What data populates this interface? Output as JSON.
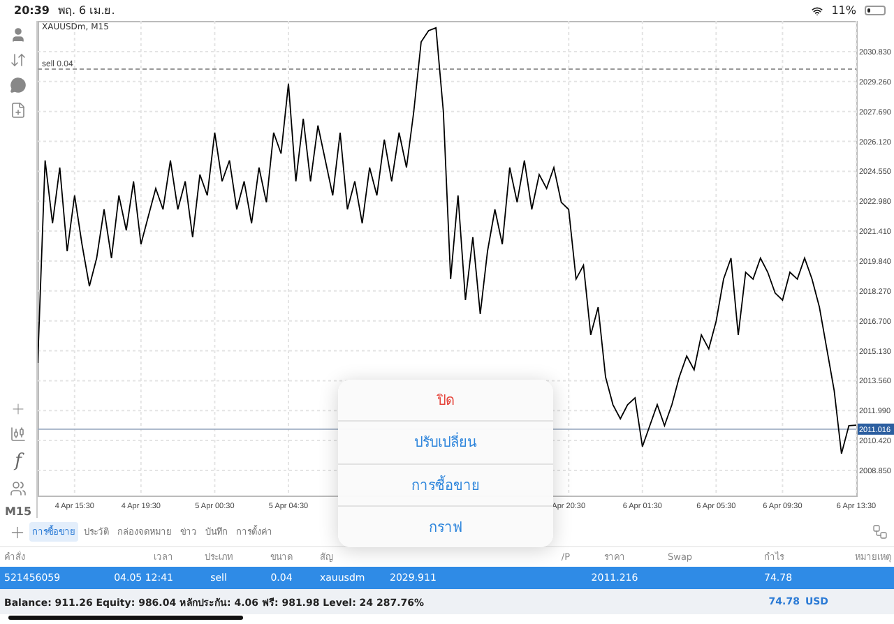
{
  "status_bar": {
    "time": "20:39",
    "date": "พฤ. 6 เม.ย.",
    "battery": "11%"
  },
  "toolbar": {
    "function_key": "f",
    "timeframe": "M15"
  },
  "chart": {
    "chart_data": {
      "type": "line",
      "title": "XAUUSDm, M15",
      "grid": true,
      "categories": [
        null,
        null,
        null,
        null,
        null,
        "4 Apr 15:30",
        null,
        null,
        null,
        null,
        null,
        null,
        null,
        null,
        "4 Apr 19:30",
        null,
        null,
        null,
        null,
        null,
        null,
        null,
        null,
        null,
        "5 Apr 00:30",
        null,
        null,
        null,
        null,
        null,
        null,
        null,
        null,
        null,
        "5 Apr 04:30",
        null,
        null,
        null,
        null,
        null,
        null,
        null,
        null,
        null,
        null,
        null,
        null,
        null,
        null,
        null,
        null,
        null,
        null,
        null,
        null,
        null,
        null,
        null,
        null,
        null,
        null,
        null,
        null,
        null,
        null,
        null,
        null,
        null,
        null,
        null,
        null,
        null,
        "Apr 20:30",
        null,
        null,
        null,
        null,
        null,
        null,
        null,
        null,
        null,
        "6 Apr 01:30",
        null,
        null,
        null,
        null,
        null,
        null,
        null,
        null,
        null,
        "6 Apr 05:30",
        null,
        null,
        null,
        null,
        null,
        null,
        null,
        null,
        "6 Apr 09:30",
        null,
        null,
        null,
        null,
        null,
        null,
        null,
        null,
        null,
        "6 Apr 13:30"
      ],
      "series": [
        {
          "color": "#000000",
          "values": [
            2014.49,
            2025.12,
            2021.82,
            2024.75,
            2020.35,
            2023.28,
            2020.72,
            2018.52,
            2019.99,
            2022.55,
            2019.99,
            2023.28,
            2021.45,
            2024.02,
            2020.72,
            2022.19,
            2023.65,
            2022.55,
            2025.12,
            2022.55,
            2024.02,
            2021.09,
            2024.38,
            2023.28,
            2026.58,
            2024.02,
            2025.12,
            2022.55,
            2024.02,
            2021.82,
            2024.75,
            2022.92,
            2026.58,
            2025.48,
            2029.15,
            2024.02,
            2027.31,
            2024.02,
            2026.95,
            2025.12,
            2023.28,
            2026.58,
            2022.55,
            2024.02,
            2021.82,
            2024.75,
            2023.28,
            2026.21,
            2024.02,
            2026.58,
            2024.75,
            2027.68,
            2031.34,
            2031.93,
            2032.08,
            2027.68,
            2018.89,
            2023.28,
            2017.79,
            2021.09,
            2017.06,
            2020.35,
            2022.55,
            2020.72,
            2024.75,
            2022.92,
            2025.12,
            2022.55,
            2024.38,
            2023.65,
            2024.75,
            2022.92,
            2022.55,
            2018.89,
            2019.62,
            2015.96,
            2017.42,
            2013.76,
            2012.3,
            2011.56,
            2012.3,
            2012.66,
            2010.1,
            2011.2,
            2012.3,
            2011.2,
            2012.3,
            2013.76,
            2014.86,
            2014.13,
            2015.96,
            2015.23,
            2016.69,
            2018.89,
            2019.99,
            2015.96,
            2019.25,
            2018.89,
            2019.99,
            2019.25,
            2018.16,
            2017.79,
            2019.25,
            2018.89,
            2019.99,
            2018.89,
            2017.42,
            2015.23,
            2013.03,
            2009.73,
            2011.2,
            2011.22
          ]
        }
      ],
      "ylim": [
        2007.53,
        2032.44
      ],
      "yticks": [
        {
          "value": 2030.83,
          "label": "2030.830"
        },
        {
          "value": 2029.26,
          "label": "2029.260"
        },
        {
          "value": 2027.69,
          "label": "2027.690"
        },
        {
          "value": 2026.12,
          "label": "2026.120"
        },
        {
          "value": 2024.55,
          "label": "2024.550"
        },
        {
          "value": 2022.98,
          "label": "2022.980"
        },
        {
          "value": 2021.41,
          "label": "2021.410"
        },
        {
          "value": 2019.84,
          "label": "2019.840"
        },
        {
          "value": 2018.27,
          "label": "2018.270"
        },
        {
          "value": 2016.7,
          "label": "2016.700"
        },
        {
          "value": 2015.13,
          "label": "2015.130"
        },
        {
          "value": 2013.56,
          "label": "2013.560"
        },
        {
          "value": 2011.99,
          "label": "2011.990"
        },
        {
          "value": 2010.42,
          "label": "2010.420"
        },
        {
          "value": 2008.85,
          "label": "2008.850"
        }
      ],
      "ref_lines": [
        {
          "axis": "y",
          "value": 2029.911,
          "label": "sell 0.04",
          "color": "#999999"
        },
        {
          "axis": "y",
          "value": 2011.016,
          "color": "#9aaac0"
        }
      ],
      "annotations": [
        {
          "y": 2011.016,
          "text": "2011.016"
        }
      ]
    }
  },
  "tabs": [
    {
      "label": "การซื้อขาย",
      "selected": true
    },
    {
      "label": "ประวัติ",
      "selected": false
    },
    {
      "label": "กล่องจดหมาย",
      "selected": false
    },
    {
      "label": "ข่าว",
      "selected": false
    },
    {
      "label": "บันทึก",
      "selected": false
    },
    {
      "label": "การตั้งค่า",
      "selected": false
    }
  ],
  "table": {
    "columns": [
      {
        "label": "คำสั่ง"
      },
      {
        "label": "เวลา"
      },
      {
        "label": "ประเภท"
      },
      {
        "label": "ขนาด"
      },
      {
        "label": "สัญ"
      },
      {},
      {},
      {
        "label": "/P"
      },
      {
        "label": "ราคา"
      },
      {
        "label": "Swap"
      },
      {
        "label": "กำไร"
      },
      {
        "label": "หมายเหตุ"
      }
    ],
    "rows": [
      {
        "selected": true,
        "cells": [
          "521456059",
          "04.05 12:41",
          "sell",
          "0.04",
          "xauusdm",
          "2029.911",
          null,
          null,
          "2011.216",
          null,
          "74.78",
          null
        ]
      }
    ]
  },
  "footer": {
    "summary": "Balance: 911.26 Equity: 986.04 หลักประกัน: 4.06 ฟรี: 981.98 Level: 24 287.76%",
    "profit": "74.78",
    "currency": "USD"
  },
  "popup_menu": {
    "items": [
      {
        "label": "ปิด",
        "kind": "destructive"
      },
      {
        "label": "ปรับเปลี่ยน",
        "kind": "default"
      },
      {
        "label": "การซื้อขาย",
        "kind": "default"
      },
      {
        "label": "กราฟ",
        "kind": "default"
      }
    ]
  }
}
